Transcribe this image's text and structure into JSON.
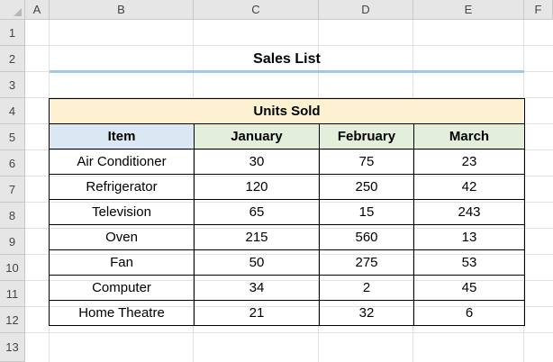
{
  "columns": [
    "A",
    "B",
    "C",
    "D",
    "E",
    "F"
  ],
  "rows": [
    "1",
    "2",
    "3",
    "4",
    "5",
    "6",
    "7",
    "8",
    "9",
    "10",
    "11",
    "12",
    "13"
  ],
  "title": "Sales List",
  "table": {
    "group_header": "Units Sold",
    "headers": [
      "Item",
      "January",
      "February",
      "March"
    ],
    "rows": [
      [
        "Air Conditioner",
        "30",
        "75",
        "23"
      ],
      [
        "Refrigerator",
        "120",
        "250",
        "42"
      ],
      [
        "Television",
        "65",
        "15",
        "243"
      ],
      [
        "Oven",
        "215",
        "560",
        "13"
      ],
      [
        "Fan",
        "50",
        "275",
        "53"
      ],
      [
        "Computer",
        "34",
        "2",
        "45"
      ],
      [
        "Home Theatre",
        "21",
        "32",
        "6"
      ]
    ]
  },
  "colors": {
    "units_sold_fill": "#fdf1d2",
    "item_header_fill": "#dbe8f4",
    "month_header_fill": "#e3efda",
    "title_underline": "#a9c4e0"
  }
}
